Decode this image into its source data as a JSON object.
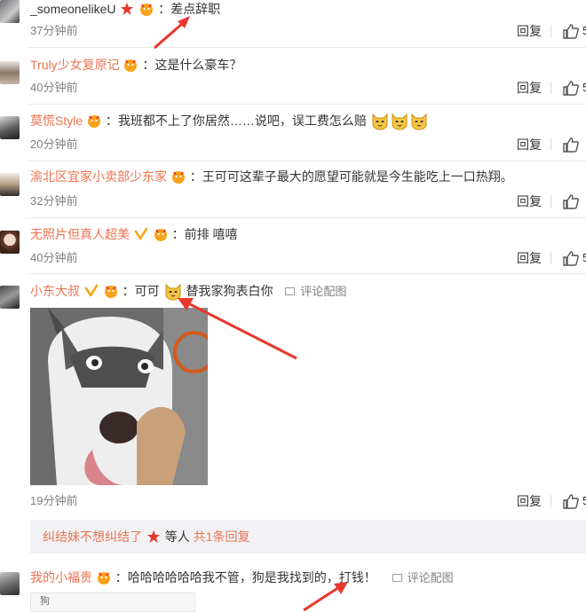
{
  "comments": [
    {
      "user": "_someonelikeU",
      "text": "：差点辞职",
      "time": "37分钟前",
      "reply": "回复",
      "likes": "5"
    },
    {
      "user": "Truly少女复原记",
      "text": "：这是什么豪车？",
      "time": "40分钟前",
      "reply": "回复",
      "likes": "5"
    },
    {
      "user": "莫慌Style",
      "text": "：我班都不上了你居然……说吧，误工费怎么赔",
      "time": "20分钟前",
      "reply": "回复",
      "likes": ""
    },
    {
      "user": "渝北区宜家小卖部少东家",
      "text": "：王可可这辈子最大的愿望可能就是今生能吃上一口热翔。",
      "time": "32分钟前",
      "reply": "回复",
      "likes": ""
    },
    {
      "user": "无照片但真人超美",
      "text": "：前排 嘻嘻",
      "time": "40分钟前",
      "reply": "回复",
      "likes": "5"
    },
    {
      "user": "小东大叔",
      "text_a": "：可可",
      "text_b": "替我家狗表白你",
      "pic_link": "评论配图",
      "time": "19分钟前",
      "reply": "回复",
      "likes": "5"
    },
    {
      "user": "我的小福贵",
      "text_a": "：哈哈哈哈哈哈我不管，狗是我找到的，",
      "text_b": "打钱！",
      "pic_link": "评论配图"
    }
  ],
  "subreplies": {
    "lead": "纠结妹不想纠结了",
    "middle": "等人",
    "count": "共1条回复"
  },
  "bottom_preview": "狗",
  "colors": {
    "username": "#eb7350",
    "arrow": "#e8372c",
    "badge": "#f9a21c",
    "vip": "#f6a91a"
  }
}
